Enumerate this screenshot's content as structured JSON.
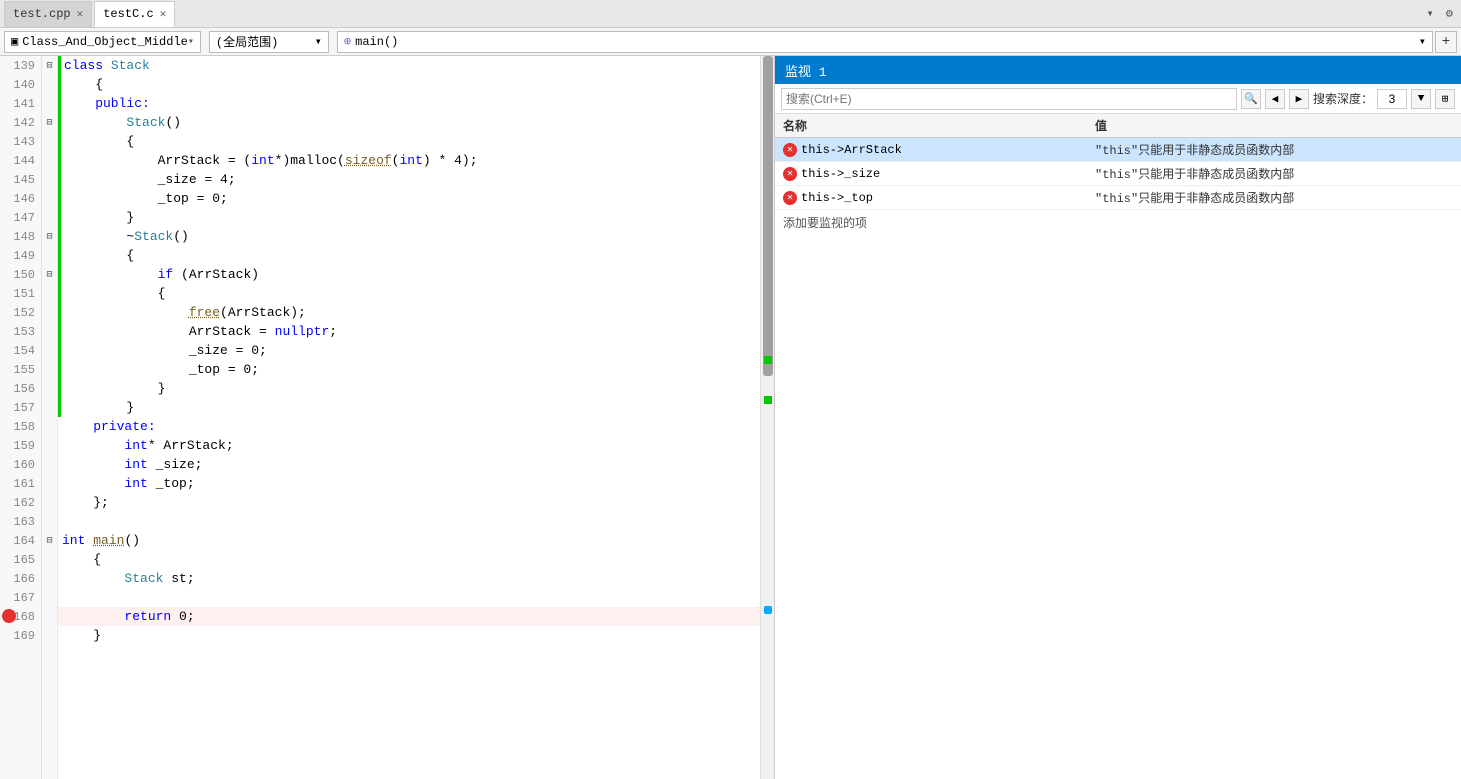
{
  "tabs": [
    {
      "id": "test-cpp",
      "label": "test.cpp",
      "active": false,
      "modified": false
    },
    {
      "id": "testC-c",
      "label": "testC.c",
      "active": true,
      "modified": false
    }
  ],
  "navbar": {
    "class_dropdown": "Class_And_Object_Middle",
    "scope_dropdown": "(全局范围)",
    "func_dropdown": "⊕ main()",
    "plus_label": "+"
  },
  "editor": {
    "lines": [
      {
        "num": 139,
        "indent": 1,
        "collapse": true,
        "code": "class Stack",
        "green": true,
        "tokens": [
          {
            "t": "kw",
            "v": "class"
          },
          {
            "t": "",
            "v": " "
          },
          {
            "t": "cls-name",
            "v": "Stack"
          }
        ]
      },
      {
        "num": 140,
        "indent": 2,
        "code": "    {",
        "green": true,
        "tokens": [
          {
            "t": "",
            "v": "    {"
          }
        ]
      },
      {
        "num": 141,
        "indent": 2,
        "code": "    public:",
        "green": true,
        "tokens": [
          {
            "t": "kw",
            "v": "    public:"
          }
        ]
      },
      {
        "num": 142,
        "indent": 2,
        "collapse": true,
        "code": "        Stack()",
        "green": true,
        "tokens": [
          {
            "t": "",
            "v": "        "
          },
          {
            "t": "cls-name",
            "v": "Stack"
          },
          {
            "t": "",
            "v": "()"
          }
        ]
      },
      {
        "num": 143,
        "indent": 3,
        "code": "        {",
        "green": true,
        "tokens": [
          {
            "t": "",
            "v": "        {"
          }
        ]
      },
      {
        "num": 144,
        "indent": 3,
        "code": "            ArrStack = (int*)malloc(sizeof(int) * 4);",
        "green": true,
        "tokens": [
          {
            "t": "",
            "v": "            ArrStack = ("
          },
          {
            "t": "kw",
            "v": "int"
          },
          {
            "t": "",
            "v": "*)malloc("
          },
          {
            "t": "fn",
            "v": "sizeof"
          },
          {
            "t": "",
            "v": "("
          },
          {
            "t": "kw",
            "v": "int"
          },
          {
            "t": "",
            "v": ") * 4);"
          }
        ]
      },
      {
        "num": 145,
        "indent": 3,
        "code": "            _size = 4;",
        "green": true,
        "tokens": [
          {
            "t": "",
            "v": "            _size = 4;"
          }
        ]
      },
      {
        "num": 146,
        "indent": 3,
        "code": "            _top = 0;",
        "green": true,
        "tokens": [
          {
            "t": "",
            "v": "            _top = 0;"
          }
        ]
      },
      {
        "num": 147,
        "indent": 3,
        "code": "        }",
        "green": true,
        "tokens": [
          {
            "t": "",
            "v": "        }"
          }
        ]
      },
      {
        "num": 148,
        "indent": 2,
        "collapse": true,
        "code": "        ~Stack()",
        "green": true,
        "tokens": [
          {
            "t": "",
            "v": "        ~"
          },
          {
            "t": "cls-name",
            "v": "Stack"
          },
          {
            "t": "",
            "v": "()"
          },
          {
            "t": "squiggle",
            "v": ""
          }
        ]
      },
      {
        "num": 149,
        "indent": 3,
        "code": "        {",
        "green": true,
        "tokens": [
          {
            "t": "",
            "v": "        {"
          }
        ]
      },
      {
        "num": 150,
        "indent": 3,
        "collapse": true,
        "code": "            if (ArrStack)",
        "green": true,
        "tokens": [
          {
            "t": "",
            "v": "            "
          },
          {
            "t": "kw",
            "v": "if"
          },
          {
            "t": "",
            "v": " (ArrStack)"
          }
        ]
      },
      {
        "num": 151,
        "indent": 4,
        "code": "            {",
        "green": true,
        "tokens": [
          {
            "t": "",
            "v": "            {"
          }
        ]
      },
      {
        "num": 152,
        "indent": 4,
        "code": "                free(ArrStack);",
        "green": true,
        "tokens": [
          {
            "t": "",
            "v": "                "
          },
          {
            "t": "fn",
            "v": "free"
          },
          {
            "t": "",
            "v": "(ArrStack);"
          }
        ]
      },
      {
        "num": 153,
        "indent": 4,
        "code": "                ArrStack = nullptr;",
        "green": true,
        "tokens": [
          {
            "t": "",
            "v": "                ArrStack = "
          },
          {
            "t": "kw",
            "v": "nullptr"
          },
          {
            "t": "",
            "v": ";"
          }
        ]
      },
      {
        "num": 154,
        "indent": 4,
        "code": "                _size = 0;",
        "green": true,
        "tokens": [
          {
            "t": "",
            "v": "                _size = 0;"
          }
        ]
      },
      {
        "num": 155,
        "indent": 4,
        "code": "                _top = 0;",
        "green": true,
        "tokens": [
          {
            "t": "",
            "v": "                _top = 0;"
          }
        ]
      },
      {
        "num": 156,
        "indent": 4,
        "code": "            }",
        "green": true,
        "tokens": [
          {
            "t": "",
            "v": "            }"
          }
        ]
      },
      {
        "num": 157,
        "indent": 3,
        "code": "        }",
        "green": true,
        "tokens": [
          {
            "t": "",
            "v": "        }"
          }
        ]
      },
      {
        "num": 158,
        "indent": 2,
        "code": "    private:",
        "green": false,
        "tokens": [
          {
            "t": "kw",
            "v": "    private:"
          }
        ]
      },
      {
        "num": 159,
        "indent": 2,
        "code": "        int* ArrStack;",
        "green": false,
        "tokens": [
          {
            "t": "",
            "v": "        "
          },
          {
            "t": "kw",
            "v": "int"
          },
          {
            "t": "",
            "v": "* ArrStack;"
          }
        ]
      },
      {
        "num": 160,
        "indent": 2,
        "code": "        int _size;",
        "green": false,
        "tokens": [
          {
            "t": "",
            "v": "        "
          },
          {
            "t": "kw",
            "v": "int"
          },
          {
            "t": "",
            "v": " _size;"
          }
        ]
      },
      {
        "num": 161,
        "indent": 2,
        "code": "        int _top;",
        "green": false,
        "tokens": [
          {
            "t": "",
            "v": "        "
          },
          {
            "t": "kw",
            "v": "int"
          },
          {
            "t": "",
            "v": " _top;"
          }
        ]
      },
      {
        "num": 162,
        "indent": 2,
        "code": "    };",
        "green": false,
        "tokens": [
          {
            "t": "",
            "v": "    };"
          }
        ]
      },
      {
        "num": 163,
        "indent": 1,
        "code": "",
        "green": false,
        "tokens": []
      },
      {
        "num": 164,
        "indent": 1,
        "collapse": true,
        "code": "int main()",
        "green": false,
        "tokens": [
          {
            "t": "kw",
            "v": "int"
          },
          {
            "t": "",
            "v": " "
          },
          {
            "t": "fn",
            "v": "main"
          },
          {
            "t": "",
            "v": "()"
          }
        ]
      },
      {
        "num": 165,
        "indent": 2,
        "code": "    {",
        "green": false,
        "tokens": [
          {
            "t": "",
            "v": "    {"
          }
        ]
      },
      {
        "num": 166,
        "indent": 2,
        "code": "        Stack st;",
        "green": false,
        "tokens": [
          {
            "t": "",
            "v": "        "
          },
          {
            "t": "cls-name",
            "v": "Stack"
          },
          {
            "t": "",
            "v": " st;"
          }
        ]
      },
      {
        "num": 167,
        "indent": 2,
        "code": "",
        "green": false,
        "tokens": []
      },
      {
        "num": 168,
        "indent": 2,
        "code": "        return 0;",
        "green": false,
        "has_breakpoint": true,
        "tokens": [
          {
            "t": "",
            "v": "        "
          },
          {
            "t": "kw",
            "v": "return"
          },
          {
            "t": "",
            "v": " 0;"
          }
        ]
      },
      {
        "num": 169,
        "indent": 2,
        "code": "    }",
        "green": false,
        "tokens": [
          {
            "t": "",
            "v": "    }"
          }
        ]
      }
    ]
  },
  "watch": {
    "panel_title": "监视 1",
    "search_placeholder": "搜索(Ctrl+E)",
    "depth_label": "搜索深度：",
    "depth_value": "3",
    "col_name": "名称",
    "col_value": "值",
    "items": [
      {
        "name": "this->ArrStack",
        "value": "\"this\"只能用于非静态成员函数内部",
        "has_error": true,
        "selected": true
      },
      {
        "name": "this->_size",
        "value": "\"this\"只能用于非静态成员函数内部",
        "has_error": true,
        "selected": false
      },
      {
        "name": "this->_top",
        "value": "\"this\"只能用于非静态成员函数内部",
        "has_error": true,
        "selected": false
      }
    ],
    "add_label": "添加要监视的项"
  }
}
